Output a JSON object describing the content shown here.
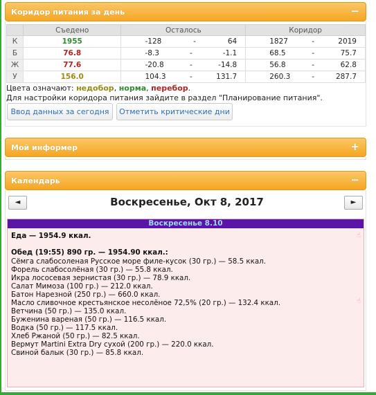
{
  "corridor_panel": {
    "title": "Коридор питания за день",
    "toggle": "−",
    "headers": [
      "",
      "Съедено",
      "Осталось",
      "Коридор"
    ],
    "rows": [
      {
        "letter": "К",
        "eaten": "1955",
        "eaten_color": "#2e8b2e",
        "rem_from": "-128",
        "rem_dash": "-",
        "rem_to": "64",
        "cor_from": "1827",
        "cor_dash": "-",
        "cor_to": "2019"
      },
      {
        "letter": "Б",
        "eaten": "76.8",
        "eaten_color": "#b22222",
        "rem_from": "-8.3",
        "rem_dash": "-",
        "rem_to": "-1.1",
        "cor_from": "68.5",
        "cor_dash": "-",
        "cor_to": "75.7"
      },
      {
        "letter": "Ж",
        "eaten": "77.6",
        "eaten_color": "#b22222",
        "rem_from": "-20.8",
        "rem_dash": "-",
        "rem_to": "-14.8",
        "cor_from": "56.8",
        "cor_dash": "-",
        "cor_to": "62.8"
      },
      {
        "letter": "У",
        "eaten": "156.0",
        "eaten_color": "#9a8a14",
        "rem_from": "104.3",
        "rem_dash": "-",
        "rem_to": "131.7",
        "cor_from": "260.3",
        "cor_dash": "-",
        "cor_to": "287.7"
      }
    ],
    "legend_prefix": "Цвета означают: ",
    "legend_under": "недобор",
    "legend_normal": "норма",
    "legend_over": "перебор",
    "legend_sep1": ", ",
    "legend_sep2": ", ",
    "legend_end": ".",
    "colors": {
      "under": "#9a8a14",
      "normal": "#2e8b2e",
      "over": "#b22222"
    },
    "hint": "Для настройки коридора питания зайдите в раздел \"Планирование питания\".",
    "button_enter": "Ввод данных за сегодня",
    "button_critical": "Отметить критические дни"
  },
  "informer_panel": {
    "title": "Мой информер",
    "toggle": "+"
  },
  "calendar_panel": {
    "title": "Календарь",
    "toggle": "−",
    "prev": "◄",
    "next": "►",
    "date_title": "Воскресенье, Окт 8, 2017",
    "day_header": "Воскресенье 8.10",
    "food_total": "Еда — 1954.9 ккал.",
    "meal_title": "Обед (19:55) 890 гр. — 1954.90 ккал.:",
    "items": [
      "Сёмга слабосоленая Русское море филе-кусок (30 гр.) — 58.5 ккал.",
      "Форель слабосолёная (30 гр.) — 55.8 ккал.",
      "Икра лососевая зернистая (30 гр.) — 78.9 ккал.",
      "Салат Мимоза (100 гр.) — 212.0 ккал.",
      "Батон Нарезной (250 гр.) — 660.0 ккал.",
      "Масло сливочное крестьянское несолёное 72,5% (20 гр.) — 132.4 ккал.",
      "Ветчина (50 гр.) — 135.0 ккал.",
      "Буженина вареная (50 гр.) — 116.5 ккал.",
      "Водка (50 гр.) — 117.5 ккал.",
      "Хлеб Ржаной (50 гр.) — 82.5 ккал.",
      "Вермут Martini Extra Dry сухой (200 гр.) — 220.0 ккал.",
      "Свиной балык (30 гр.) — 85.8 ккал."
    ],
    "hand_icon": "☝"
  }
}
